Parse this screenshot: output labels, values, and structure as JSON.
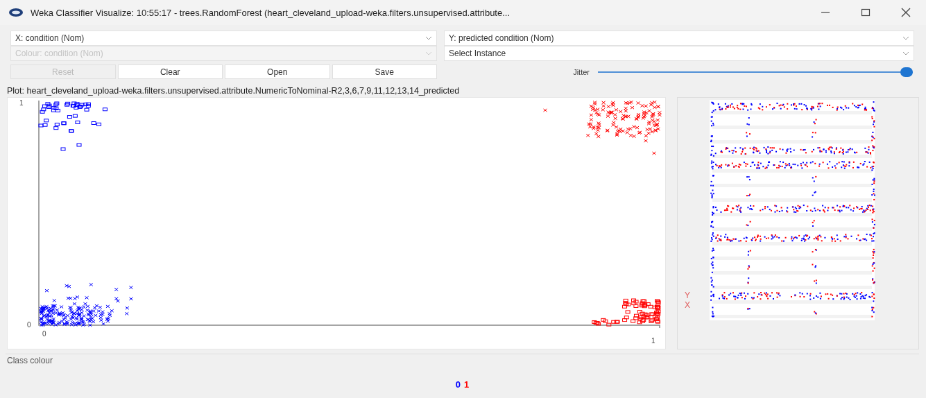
{
  "window": {
    "title": "Weka Classifier Visualize: 10:55:17 - trees.RandomForest (heart_cleveland_upload-weka.filters.unsupervised.attribute..."
  },
  "x_axis_select": {
    "value": "X: condition (Nom)",
    "disabled": false
  },
  "colour_select": {
    "value": "Colour: condition (Nom)",
    "disabled": true
  },
  "y_axis_select": {
    "value": "Y: predicted condition (Nom)",
    "disabled": false
  },
  "instance_select": {
    "value": "Select Instance",
    "disabled": false
  },
  "buttons": [
    {
      "label": "Reset",
      "disabled": true
    },
    {
      "label": "Clear",
      "disabled": false
    },
    {
      "label": "Open",
      "disabled": false
    },
    {
      "label": "Save",
      "disabled": false
    }
  ],
  "jitter": {
    "label": "Jitter",
    "level": 1.0
  },
  "plot": {
    "title": "Plot: heart_cleveland_upload-weka.filters.unsupervised.attribute.NumericToNominal-R2,3,6,7,9,11,12,13,14_predicted",
    "y_ticks": [
      "1",
      "0"
    ],
    "x_ticks": [
      "0",
      "1"
    ]
  },
  "attribute_panel": {
    "markers": [
      "Y",
      "X"
    ]
  },
  "class_colour": {
    "title": "Class colour",
    "classes": [
      {
        "label": "0",
        "color": "#0000ff"
      },
      {
        "label": "1",
        "color": "#ff0000"
      }
    ]
  }
}
